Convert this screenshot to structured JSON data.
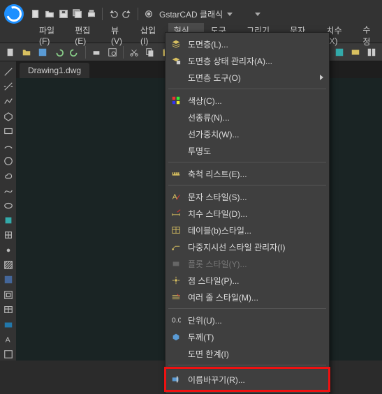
{
  "title": {
    "workspace": "GstarCAD 클래식"
  },
  "menu": {
    "file": "파일(F)",
    "edit": "편집(E)",
    "view": "뷰(V)",
    "insert": "삽입(I)",
    "format": "형식(O)",
    "tools": "도구(T)",
    "draw": "그리기(D)",
    "text": "문자(N)",
    "dimension": "치수(X)",
    "modify": "수정"
  },
  "tab": {
    "drawing1": "Drawing1.dwg"
  },
  "dd": {
    "layer": "도면층(L)...",
    "layerstate": "도면층 상태 관리자(A)...",
    "layertools": "도면층 도구(O)",
    "color": "색상(C)...",
    "linetype": "선종류(N)...",
    "lineweight": "선가중치(W)...",
    "transparency": "투명도",
    "scalelist": "축척 리스트(E)...",
    "textstyle": "문자 스타일(S)...",
    "dimstyle": "치수 스타일(D)...",
    "tablestyle": "테이블(b)스타일...",
    "mleaderstyle": "다중지시선 스타일 관리자(I)",
    "plotstyle": "플롯 스타일(Y)...",
    "pointstyle": "점 스타일(P)...",
    "mlinestyle": "여러 줄 스타일(M)...",
    "units": "단위(U)...",
    "thickness": "두께(T)",
    "limits": "도면 한계(I)",
    "rename": "이름바꾸기(R)..."
  }
}
